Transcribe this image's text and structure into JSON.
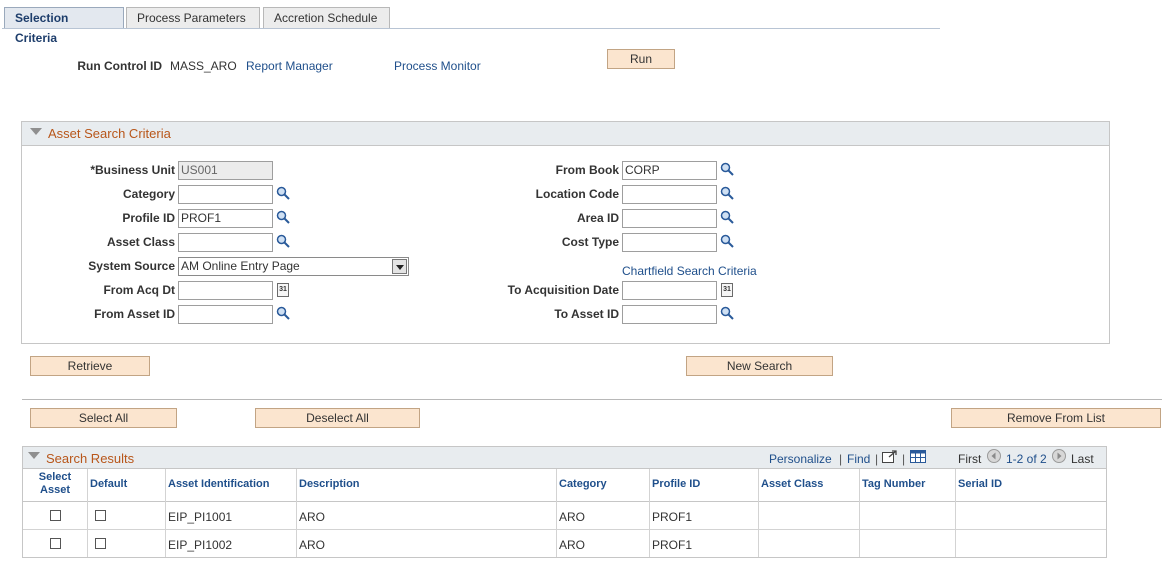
{
  "tabs": [
    {
      "label": "Selection Criteria",
      "active": true
    },
    {
      "label": "Process Parameters",
      "active": false
    },
    {
      "label": "Accretion Schedule",
      "active": false
    }
  ],
  "header": {
    "run_control_label": "Run Control ID",
    "run_control_value": "MASS_ARO",
    "report_manager": "Report Manager",
    "process_monitor": "Process Monitor",
    "run_label": "Run"
  },
  "search_criteria": {
    "title": "Asset Search Criteria",
    "business_unit": {
      "label": "*Business Unit",
      "value": "US001"
    },
    "category": {
      "label": "Category",
      "value": ""
    },
    "profile_id": {
      "label": "Profile ID",
      "value": "PROF1"
    },
    "asset_class": {
      "label": "Asset Class",
      "value": ""
    },
    "system_source": {
      "label": "System Source",
      "value": "AM Online Entry Page"
    },
    "from_acq_dt": {
      "label": "From Acq Dt",
      "value": ""
    },
    "from_asset_id": {
      "label": "From Asset ID",
      "value": ""
    },
    "from_book": {
      "label": "From Book",
      "value": "CORP"
    },
    "location_code": {
      "label": "Location Code",
      "value": ""
    },
    "area_id": {
      "label": "Area ID",
      "value": ""
    },
    "cost_type": {
      "label": "Cost Type",
      "value": ""
    },
    "chartfield_link": "Chartfield Search Criteria",
    "to_acq_date": {
      "label": "To Acquisition Date",
      "value": ""
    },
    "to_asset_id": {
      "label": "To Asset ID",
      "value": ""
    },
    "calendar_glyph": "31"
  },
  "buttons": {
    "retrieve": "Retrieve",
    "new_search": "New Search",
    "select_all": "Select All",
    "deselect_all": "Deselect All",
    "remove_from_list": "Remove From List"
  },
  "results": {
    "title": "Search Results",
    "personalize": "Personalize",
    "separator": "|",
    "find": "Find",
    "first": "First",
    "range": "1-2 of 2",
    "last": "Last",
    "columns": {
      "select_asset_1": "Select",
      "select_asset_2": "Asset",
      "default": "Default",
      "asset_identification": "Asset Identification",
      "description": "Description",
      "category": "Category",
      "profile_id": "Profile ID",
      "asset_class": "Asset Class",
      "tag_number": "Tag Number",
      "serial_id": "Serial ID"
    },
    "rows": [
      {
        "asset_id": "EIP_PI1001",
        "description": "ARO",
        "category": "ARO",
        "profile_id": "PROF1",
        "asset_class": "",
        "tag_number": "",
        "serial_id": ""
      },
      {
        "asset_id": "EIP_PI1002",
        "description": "ARO",
        "category": "ARO",
        "profile_id": "PROF1",
        "asset_class": "",
        "tag_number": "",
        "serial_id": ""
      }
    ]
  },
  "colors": {
    "link": "#1f4f8b",
    "section_title": "#b8561a",
    "button_bg": "#fbe5cf",
    "button_border": "#c2a484"
  }
}
